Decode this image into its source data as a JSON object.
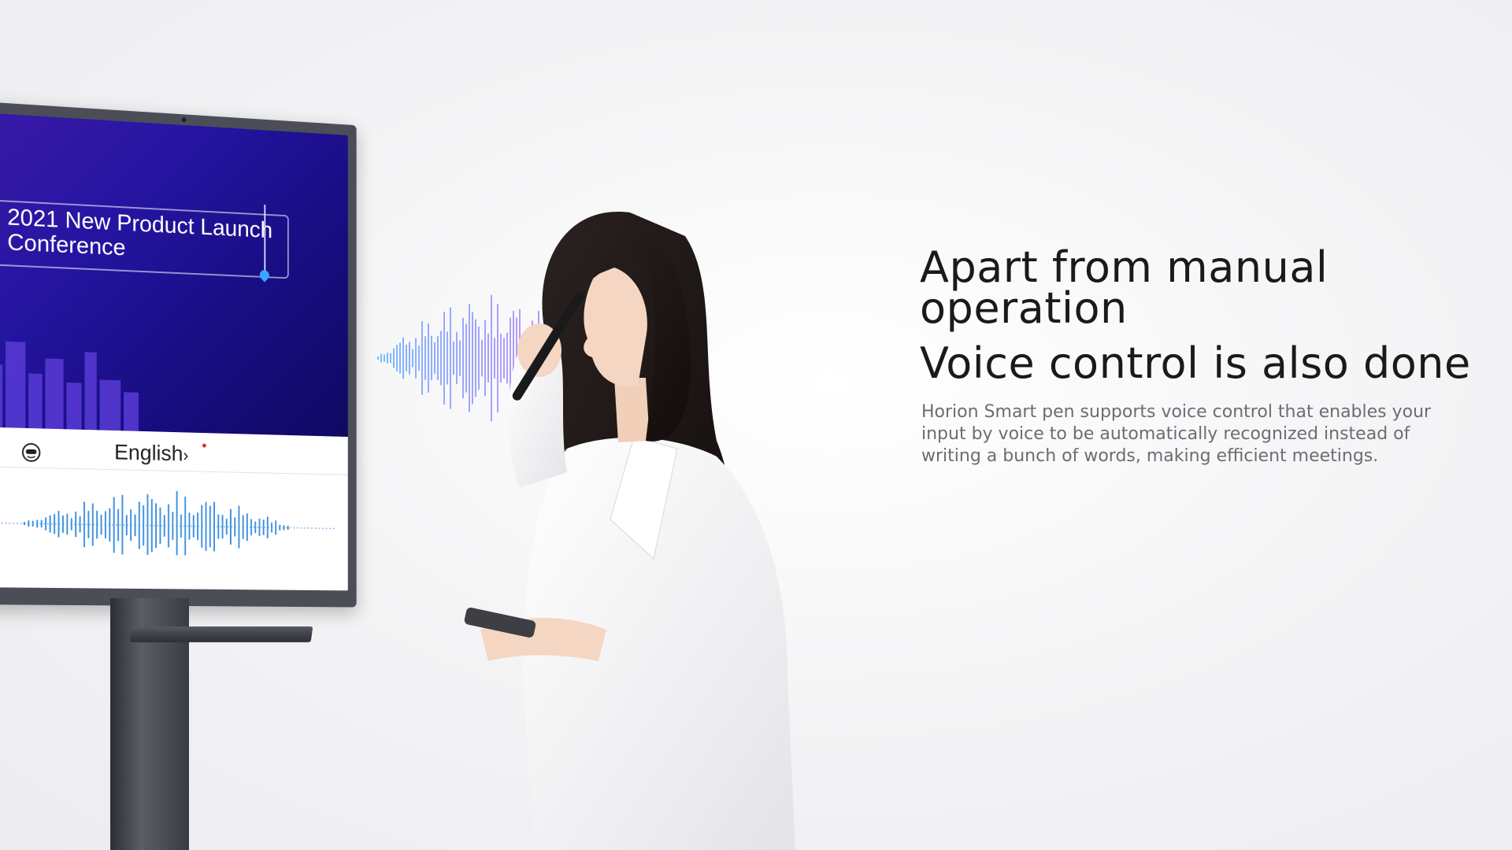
{
  "display": {
    "slide_title": "2021 New Product Launch Conference",
    "language_label": "English",
    "language_chevron": "›",
    "robot_icon": "robot-face-icon",
    "colors": {
      "slide_top": "#3a1aa8",
      "slide_bottom": "#100962",
      "wave_blue": "#3aa6ff",
      "wave_purple": "#b070f0"
    }
  },
  "content": {
    "headline_line1": "Apart from manual operation",
    "headline_line2": "Voice control is also done",
    "body": "Horion Smart pen supports voice control that enables your input by voice to be automatically recognized instead of writing a bunch of words, making efficient meetings."
  }
}
